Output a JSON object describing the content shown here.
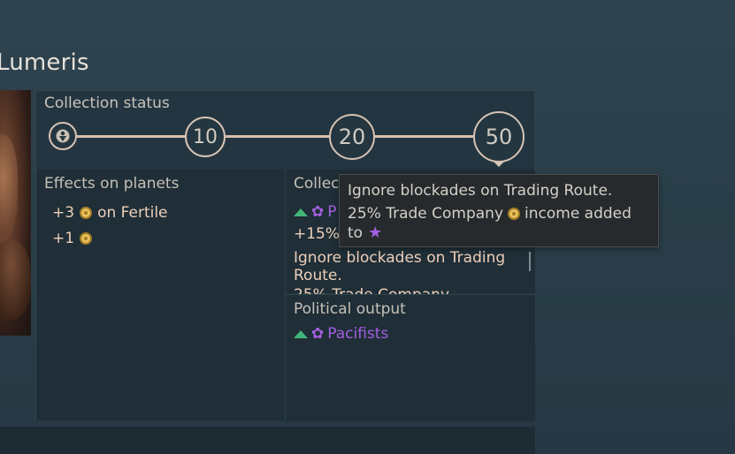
{
  "header": {
    "title": "Lumeris"
  },
  "collection": {
    "label": "Collection status",
    "milestones": [
      "10",
      "20",
      "50"
    ]
  },
  "effects": {
    "heading": "Effects on planets",
    "rows": [
      {
        "amount": "+3",
        "suffix": "on Fertile"
      },
      {
        "amount": "+1",
        "suffix": ""
      }
    ]
  },
  "collected": {
    "heading": "Collec",
    "row1_label": "P",
    "row2": "+15%",
    "text1": "Ignore blockades on Trading Route.",
    "text2": "25% Trade Company"
  },
  "political": {
    "heading": "Political output",
    "faction": "Pacifists"
  },
  "tooltip": {
    "line1": "Ignore blockades on Trading Route.",
    "line2a": "25% Trade Company",
    "line2b": "income added",
    "line3": "to"
  },
  "colors": {
    "accent_purple": "#a45fe0",
    "influence_green": "#42b678",
    "coin_gold": "#e8c15c"
  },
  "icons": [
    "coin-icon",
    "pacifist-flower-icon",
    "up-arrow-icon",
    "star-icon",
    "population-pin-icon"
  ]
}
